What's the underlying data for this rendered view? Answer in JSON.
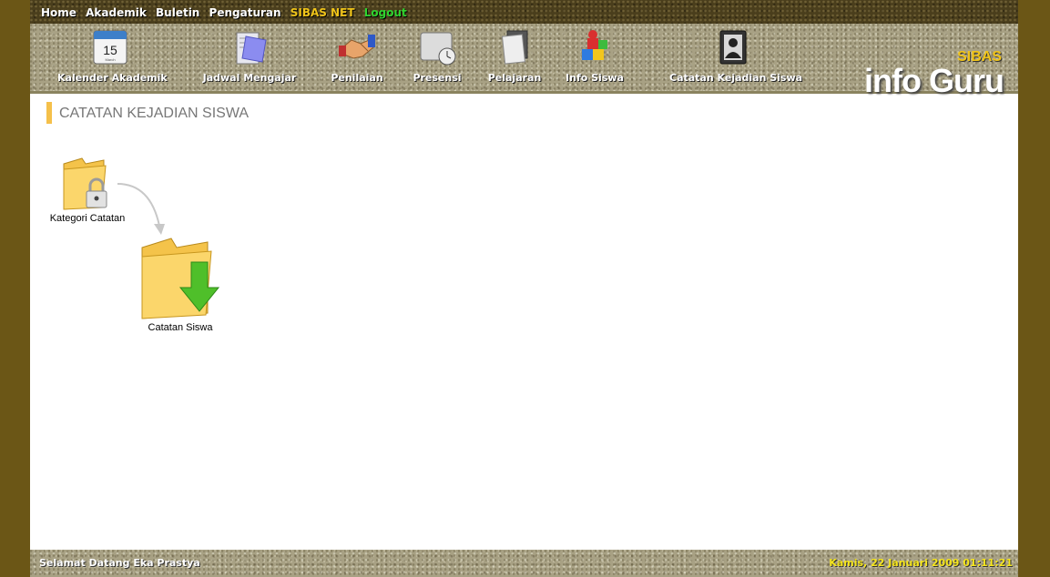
{
  "top_menu": {
    "home": "Home",
    "akademik": "Akademik",
    "buletin": "Buletin",
    "pengaturan": "Pengaturan",
    "sibas_net": "SIBAS NET",
    "logout": "Logout"
  },
  "toolbar": {
    "items": [
      {
        "label": "Kalender Akademik",
        "icon": "calendar-icon",
        "date_num": "15",
        "date_sub": "March"
      },
      {
        "label": "Jadwal Mengajar",
        "icon": "notebook-icon"
      },
      {
        "label": "Penilaian",
        "icon": "handshake-icon"
      },
      {
        "label": "Presensi",
        "icon": "clock-card-icon"
      },
      {
        "label": "Pelajaran",
        "icon": "papers-icon"
      },
      {
        "label": "Info Siswa",
        "icon": "blocks-icon"
      },
      {
        "label": "Catatan Kejadian Siswa",
        "icon": "person-card-icon"
      }
    ]
  },
  "logo": {
    "top": "SIBAS",
    "main": "info Guru"
  },
  "page": {
    "title": "CATATAN KEJADIAN SISWA"
  },
  "content": {
    "items": [
      {
        "label": "Kategori Catatan",
        "icon": "locked-folder-icon"
      },
      {
        "label": "Catatan Siswa",
        "icon": "download-folder-icon"
      }
    ]
  },
  "footer": {
    "welcome": "Selamat Datang Eka Prastya",
    "datetime": "Kamis, 22 Januari 2009 01:11:21"
  },
  "colors": {
    "background": "#6b5616",
    "accent": "#f5c04a",
    "sibas": "#f0c419",
    "logout": "#2fd42f",
    "datetime": "#f5e51c"
  }
}
